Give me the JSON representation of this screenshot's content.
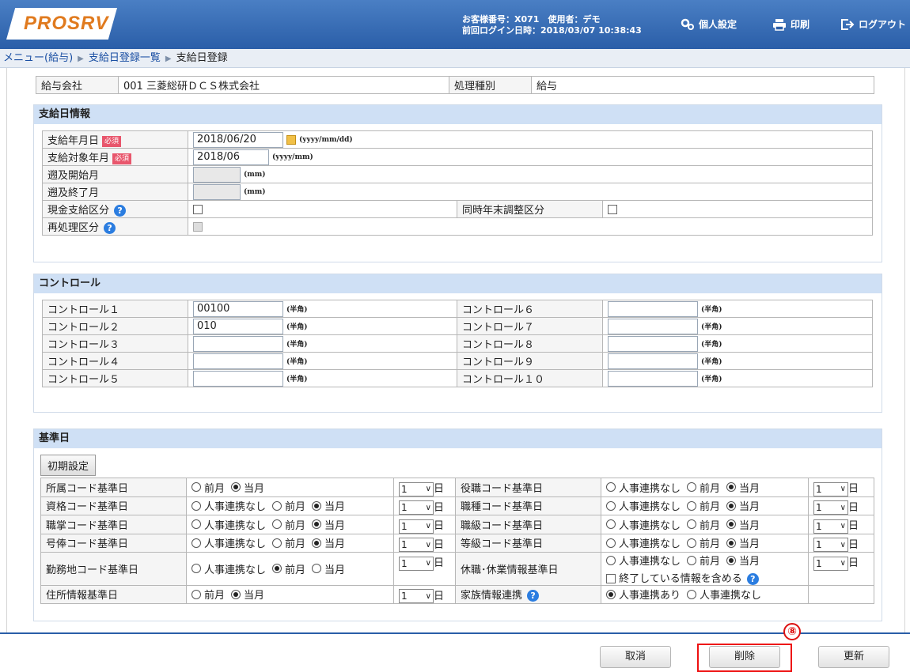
{
  "header": {
    "logo": "PROSRV",
    "customer_line": "お客様番号：X071　使用者：デモ",
    "login_line": "前回ログイン日時：2018/03/07 10:38:43",
    "settings_label": "個人設定",
    "print_label": "印刷",
    "logout_label": "ログアウト",
    "bg_color": "#2a5ea8"
  },
  "breadcrumb": {
    "items": [
      "メニュー(給与)",
      "支給日登録一覧",
      "支給日登録"
    ]
  },
  "info": {
    "company_label": "給与会社",
    "company_value": "001 三菱総研ＤＣＳ株式会社",
    "type_label": "処理種別",
    "type_value": "給与"
  },
  "payday": {
    "title": "支給日情報",
    "required_badge": "必須",
    "pay_date_label": "支給年月日",
    "pay_date_value": "2018/06/20",
    "pay_date_fmt": "(yyyy/mm/dd)",
    "target_month_label": "支給対象年月",
    "target_month_value": "2018/06",
    "target_month_fmt": "(yyyy/mm)",
    "retro_start_label": "遡及開始月",
    "retro_end_label": "遡及終了月",
    "mm_fmt": "(mm)",
    "cash_label": "現金支給区分",
    "yearend_label": "同時年末調整区分",
    "reprocess_label": "再処理区分"
  },
  "control": {
    "title": "コントロール",
    "hankaku": "(半角)",
    "left": [
      {
        "label": "コントロール１",
        "value": "00100"
      },
      {
        "label": "コントロール２",
        "value": "010"
      },
      {
        "label": "コントロール３",
        "value": ""
      },
      {
        "label": "コントロール４",
        "value": ""
      },
      {
        "label": "コントロール５",
        "value": ""
      }
    ],
    "right": [
      {
        "label": "コントロール６",
        "value": ""
      },
      {
        "label": "コントロール７",
        "value": ""
      },
      {
        "label": "コントロール８",
        "value": ""
      },
      {
        "label": "コントロール９",
        "value": ""
      },
      {
        "label": "コントロール１０",
        "value": ""
      }
    ]
  },
  "basedate": {
    "title": "基準日",
    "init_button": "初期設定",
    "day_unit": "日",
    "day_value": "1",
    "opt_none": "人事連携なし",
    "opt_prev": "前月",
    "opt_curr": "当月",
    "include_ended": "終了している情報を含める",
    "family_opt_yes": "人事連携あり",
    "family_opt_no": "人事連携なし",
    "rows": [
      {
        "left": "所属コード基準日",
        "right": "役職コード基準日"
      },
      {
        "left": "資格コード基準日",
        "right": "職種コード基準日"
      },
      {
        "left": "職掌コード基準日",
        "right": "職級コード基準日"
      },
      {
        "left": "号俸コード基準日",
        "right": "等級コード基準日"
      },
      {
        "left": "勤務地コード基準日",
        "right": "休職･休業情報基準日"
      },
      {
        "left": "住所情報基準日",
        "right": "家族情報連携"
      }
    ]
  },
  "footer": {
    "cancel": "取消",
    "delete": "削除",
    "update": "更新",
    "marker": "⑧"
  }
}
